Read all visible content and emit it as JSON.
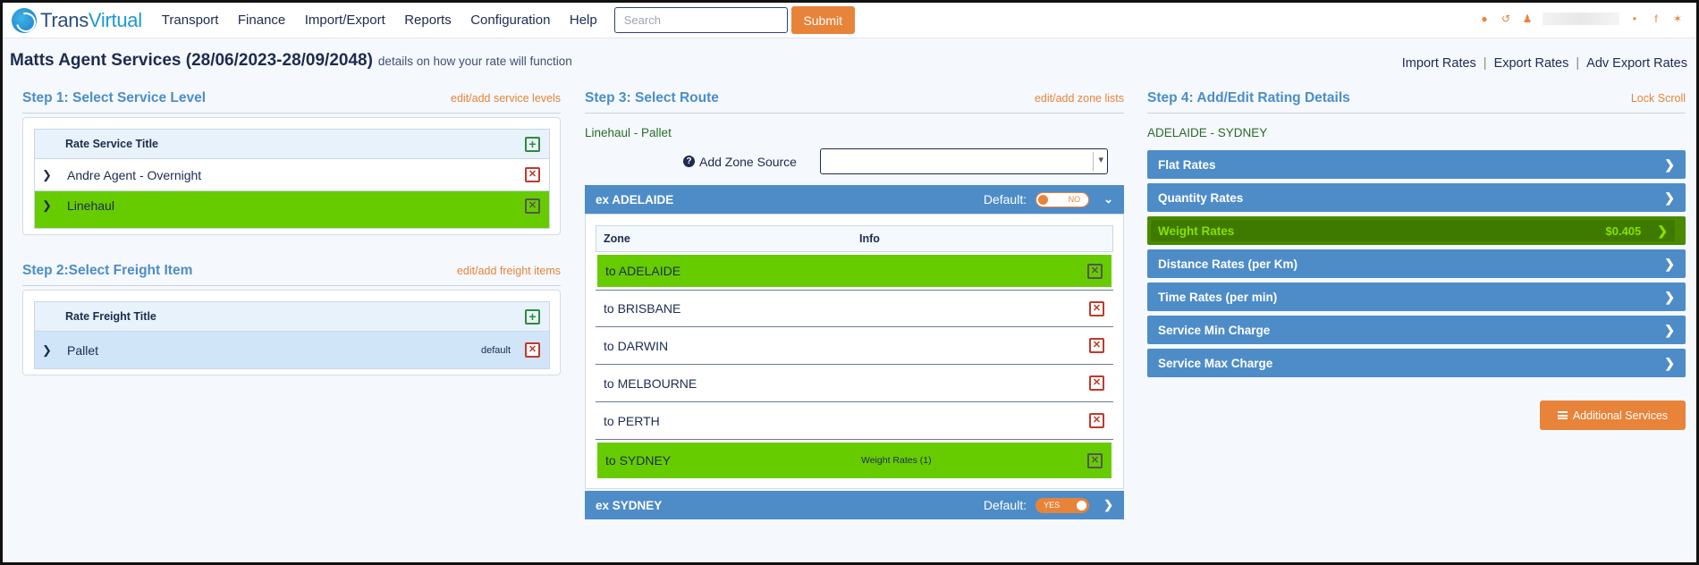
{
  "app": {
    "logo_part1": "Trans",
    "logo_part2": "Virtual"
  },
  "nav": {
    "items": [
      "Transport",
      "Finance",
      "Import/Export",
      "Reports",
      "Configuration",
      "Help"
    ],
    "search_placeholder": "Search",
    "submit_label": "Submit"
  },
  "page": {
    "title": "Matts Agent Services (28/06/2023-28/09/2048)",
    "subtitle": "details on how your rate will function",
    "links": [
      "Import Rates",
      "Export Rates",
      "Adv Export Rates"
    ]
  },
  "step1": {
    "title": "Step 1: Select Service Level",
    "link": "edit/add service levels",
    "header": "Rate Service Title",
    "rows": [
      "Andre Agent - Overnight",
      "Linehaul"
    ]
  },
  "step2": {
    "title": "Step 2:Select Freight Item",
    "link": "edit/add freight items",
    "header": "Rate Freight Title",
    "rows": [
      "Pallet"
    ],
    "default_tag": "default"
  },
  "step3": {
    "title": "Step 3: Select Route",
    "link": "edit/add zone lists",
    "route_label": "Linehaul - Pallet",
    "zone_source_label": "Add Zone Source",
    "default_label": "Default:",
    "groups": [
      {
        "name": "ex ADELAIDE",
        "toggle": "NO"
      },
      {
        "name": "ex SYDNEY",
        "toggle": "YES"
      }
    ],
    "zone_header": "Zone",
    "info_header": "Info",
    "zones": [
      {
        "name": "to ADELAIDE",
        "info": ""
      },
      {
        "name": "to BRISBANE",
        "info": ""
      },
      {
        "name": "to DARWIN",
        "info": ""
      },
      {
        "name": "to MELBOURNE",
        "info": ""
      },
      {
        "name": "to PERTH",
        "info": ""
      },
      {
        "name": "to SYDNEY",
        "info": "Weight Rates (1)"
      }
    ]
  },
  "step4": {
    "title": "Step 4: Add/Edit Rating Details",
    "link": "Lock Scroll",
    "route_label": "ADELAIDE - SYDNEY",
    "rates": [
      {
        "label": "Flat Rates",
        "value": ""
      },
      {
        "label": "Quantity Rates",
        "value": ""
      },
      {
        "label": "Weight Rates",
        "value": "$0.405"
      },
      {
        "label": "Distance Rates (per Km)",
        "value": ""
      },
      {
        "label": "Time Rates (per min)",
        "value": ""
      },
      {
        "label": "Service Min Charge",
        "value": ""
      },
      {
        "label": "Service Max Charge",
        "value": ""
      }
    ],
    "additional_label": "Additional Services"
  },
  "colors": {
    "accent": "#e8833a",
    "primary_blue": "#4e8cc8",
    "selected_green": "#66cc00",
    "active_rate": "#4a8a00"
  }
}
